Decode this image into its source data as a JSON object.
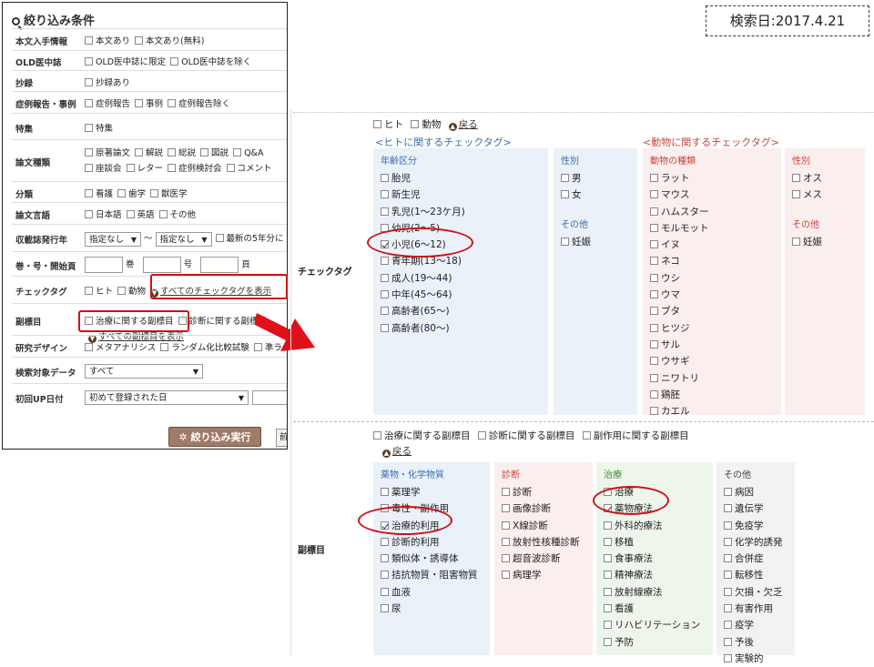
{
  "date_label": "検索日:2017.4.21",
  "left": {
    "title": "絞り込み条件",
    "rows": [
      {
        "label": "本文入手情報",
        "options": [
          "本文あり",
          "本文あり(無料)"
        ]
      },
      {
        "label": "OLD医中誌",
        "options": [
          "OLD医中誌に限定",
          "OLD医中誌を除く"
        ]
      },
      {
        "label": "抄録",
        "options": [
          "抄録あり"
        ]
      },
      {
        "label": "症例報告・事例",
        "options": [
          "症例報告",
          "事例",
          "症例報告除く"
        ]
      },
      {
        "label": "特集",
        "options": [
          "特集"
        ]
      },
      {
        "label": "論文種類",
        "options": [
          "原著論文",
          "解説",
          "総説",
          "図説",
          "Q&A",
          "座談会",
          "レター",
          "症例検討会",
          "コメント"
        ]
      },
      {
        "label": "分類",
        "options": [
          "看護",
          "歯学",
          "獣医学"
        ]
      },
      {
        "label": "論文言語",
        "options": [
          "日本語",
          "英語",
          "その他"
        ]
      },
      {
        "label": "収載誌発行年",
        "select1": "指定なし",
        "tilde": "〜",
        "select2": "指定なし",
        "option": "最新の5年分に"
      },
      {
        "label": "巻・号・開始頁",
        "vol": "巻",
        "no": "号",
        "page": "頁"
      },
      {
        "label": "チェックタグ",
        "options": [
          "ヒト",
          "動物"
        ],
        "link": "すべてのチェックタグを表示"
      },
      {
        "label": "副標目",
        "options": [
          "治療に関する副標目",
          "診断に関する副標目"
        ],
        "link": "すべての副標目を表示"
      },
      {
        "label": "研究デザイン",
        "options": [
          "メタアナリシス",
          "ランダム化比較試験",
          "準ラ"
        ]
      },
      {
        "label": "検索対象データ",
        "select": "すべて"
      },
      {
        "label": "初回UP日付",
        "select": "初めて登録された日"
      }
    ],
    "run_button": "絞り込み実行",
    "cut_button": "前"
  },
  "checktag": {
    "side_label": "チェックタグ",
    "top_options": [
      "ヒト",
      "動物"
    ],
    "back": "戻る",
    "human_head": "<ヒトに関するチェックタグ>",
    "animal_head": "<動物に関するチェックタグ>",
    "age": {
      "head": "年齢区分",
      "items": [
        "胎児",
        "新生児",
        "乳児(1〜23ケ月)",
        "幼児(2〜5)",
        "小児(6〜12)",
        "青年期(13〜18)",
        "成人(19〜44)",
        "中年(45〜64)",
        "高齢者(65〜)",
        "高齢者(80〜)"
      ],
      "checked": [
        4
      ]
    },
    "sex": {
      "head": "性別",
      "items": [
        "男",
        "女"
      ],
      "other_head": "その他",
      "other_items": [
        "妊娠"
      ]
    },
    "animal": {
      "head": "動物の種類",
      "items": [
        "ラット",
        "マウス",
        "ハムスター",
        "モルモット",
        "イヌ",
        "ネコ",
        "ウシ",
        "ウマ",
        "ブタ",
        "ヒツジ",
        "サル",
        "ウサギ",
        "ニワトリ",
        "鶏胚",
        "カエル"
      ]
    },
    "animal_sex": {
      "head": "性別",
      "items": [
        "オス",
        "メス"
      ],
      "other_head": "その他",
      "other_items": [
        "妊娠"
      ]
    }
  },
  "subheading": {
    "side_label": "副標目",
    "top_options": [
      "治療に関する副標目",
      "診断に関する副標目",
      "副作用に関する副標目"
    ],
    "back": "戻る",
    "drug": {
      "head": "薬物・化学物質",
      "items": [
        "薬理学",
        "毒性・副作用",
        "治療的利用",
        "診断的利用",
        "類似体・誘導体",
        "拮抗物質・阻害物質",
        "血液",
        "尿"
      ],
      "checked": [
        2
      ]
    },
    "diag": {
      "head": "診断",
      "items": [
        "診断",
        "画像診断",
        "X線診断",
        "放射性核種診断",
        "超音波診断",
        "病理学"
      ]
    },
    "treat": {
      "head": "治療",
      "items": [
        "治療",
        "薬物療法",
        "外科的療法",
        "移植",
        "食事療法",
        "精神療法",
        "放射線療法",
        "看護",
        "リハビリテーション",
        "予防"
      ],
      "checked": [
        1
      ]
    },
    "other": {
      "head": "その他",
      "items": [
        "病因",
        "遺伝学",
        "免疫学",
        "化学的誘発",
        "合併症",
        "転移性",
        "欠損・欠乏",
        "有害作用",
        "疫学",
        "予後",
        "実験的"
      ]
    }
  },
  "colors": {
    "accent_red": "#d0101a",
    "blue_text": "#3b6fb1",
    "pink_text": "#c9463c",
    "green_text": "#3d8c3a",
    "button": "#a07b68"
  }
}
